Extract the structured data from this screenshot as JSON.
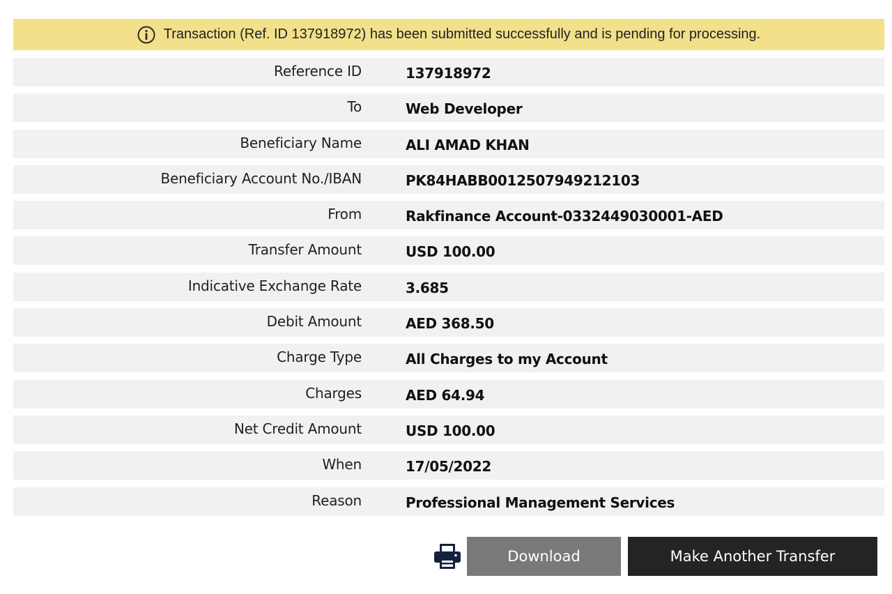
{
  "notice": {
    "icon": "info-circle-icon",
    "message": "Transaction (Ref. ID 137918972) has been submitted successfully and is pending for processing.",
    "background": "#f2e08a"
  },
  "details": [
    {
      "label": "Reference ID",
      "value": "137918972"
    },
    {
      "label": "To",
      "value": "Web Developer"
    },
    {
      "label": "Beneficiary Name",
      "value": "ALI AMAD KHAN"
    },
    {
      "label": "Beneficiary Account No./IBAN",
      "value": "PK84HABB0012507949212103"
    },
    {
      "label": "From",
      "value": "Rakfinance Account-0332449030001-AED"
    },
    {
      "label": "Transfer Amount",
      "value": "USD 100.00"
    },
    {
      "label": "Indicative Exchange Rate",
      "value": "3.685"
    },
    {
      "label": "Debit Amount",
      "value": "AED 368.50"
    },
    {
      "label": "Charge Type",
      "value": "All Charges to my Account"
    },
    {
      "label": "Charges",
      "value": "AED 64.94"
    },
    {
      "label": "Net Credit Amount",
      "value": "USD 100.00"
    },
    {
      "label": "When",
      "value": "17/05/2022"
    },
    {
      "label": "Reason",
      "value": "Professional Management Services"
    }
  ],
  "actions": {
    "print_icon": "printer-icon",
    "download_label": "Download",
    "download_color": "#7b7878",
    "transfer_label": "Make Another Transfer",
    "transfer_color": "#262323"
  }
}
